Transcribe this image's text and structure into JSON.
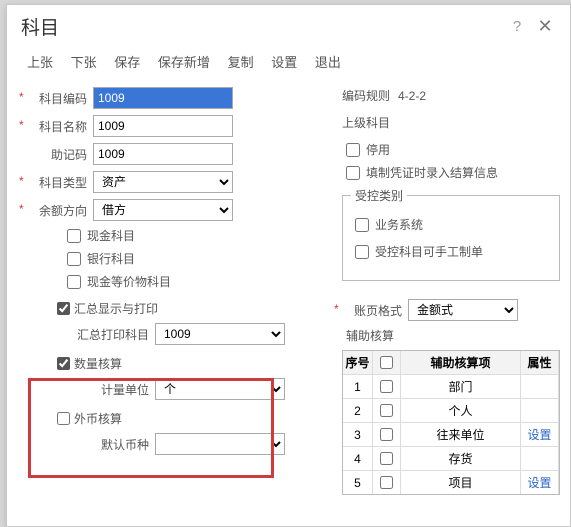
{
  "title": "科目",
  "toolbar": {
    "prev": "上张",
    "next": "下张",
    "save": "保存",
    "saveNew": "保存新增",
    "copy": "复制",
    "settings": "设置",
    "exit": "退出"
  },
  "left": {
    "code_label": "科目编码",
    "code_value": "1009",
    "name_label": "科目名称",
    "name_value": "1009",
    "mnem_label": "助记码",
    "mnem_value": "1009",
    "type_label": "科目类型",
    "type_value": "资产",
    "dir_label": "余额方向",
    "dir_value": "借方",
    "cb_cash": "现金科目",
    "cb_bank": "银行科目",
    "cb_casheq": "现金等价物科目",
    "sec_print": "汇总显示与打印",
    "print_label": "汇总打印科目",
    "print_value": "1009",
    "sec_qty": "数量核算",
    "unit_label": "计量单位",
    "unit_value": "个",
    "sec_fx": "外币核算",
    "curr_label": "默认币种",
    "curr_value": ""
  },
  "right": {
    "rule_label": "编码规则",
    "rule_value": "4-2-2",
    "parent_label": "上级科目",
    "cb_disable": "停用",
    "cb_settle": "填制凭证时录入结算信息",
    "ctrl_legend": "受控类别",
    "cb_biz": "业务系统",
    "cb_manual": "受控科目可手工制单",
    "amtfmt_label": "账页格式",
    "amtfmt_value": "金额式",
    "aux_title": "辅助核算",
    "th_seq": "序号",
    "th_cb": "",
    "th_item": "辅助核算项",
    "th_attr": "属性",
    "rows": [
      {
        "seq": "1",
        "item": "部门",
        "attr": ""
      },
      {
        "seq": "2",
        "item": "个人",
        "attr": ""
      },
      {
        "seq": "3",
        "item": "往来单位",
        "attr": "设置"
      },
      {
        "seq": "4",
        "item": "存货",
        "attr": ""
      },
      {
        "seq": "5",
        "item": "项目",
        "attr": "设置"
      }
    ]
  }
}
